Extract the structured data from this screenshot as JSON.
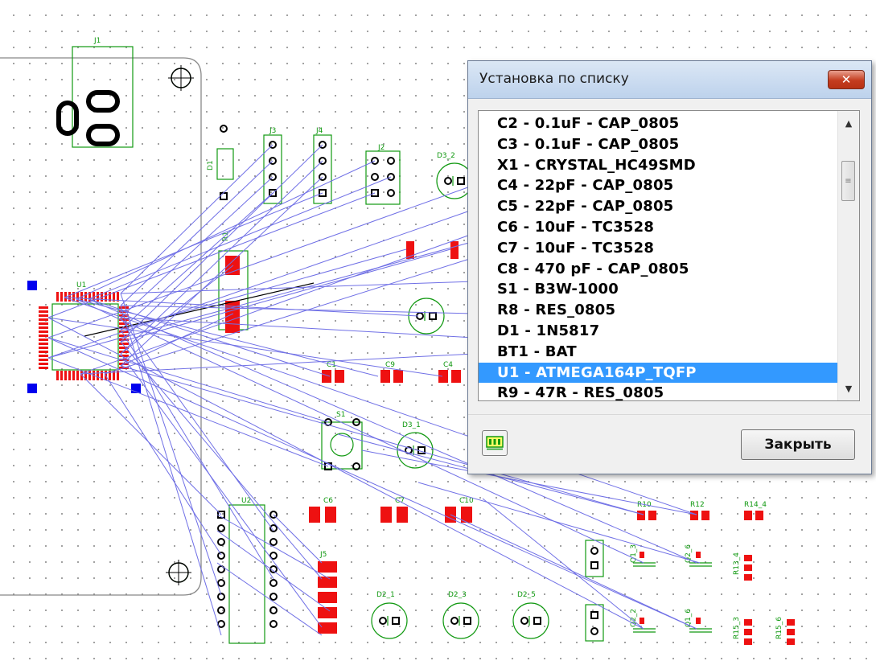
{
  "canvas": {
    "ref_labels": [
      "J1",
      "J3",
      "J4",
      "J2",
      "D1",
      "D3_2",
      "R1",
      "U1",
      "C1",
      "C9",
      "C4",
      "D3_1",
      "S1",
      "U2",
      "C6",
      "C7",
      "C10",
      "R10",
      "R12",
      "R14_4",
      "J5",
      "D2_1",
      "D2_3",
      "D2_5",
      "R13_4",
      "R15_3",
      "R15_6",
      "Q1_3",
      "Q2_6",
      "Q2_2",
      "Q1_6"
    ]
  },
  "dialog": {
    "title": "Установка по списку",
    "close_x": "✕",
    "close_button_label": "Закрыть",
    "items": [
      "C2 - 0.1uF - CAP_0805",
      "C3 - 0.1uF - CAP_0805",
      "X1 - CRYSTAL_HC49SMD",
      "C4 - 22pF - CAP_0805",
      "C5 - 22pF - CAP_0805",
      "C6 - 10uF - TC3528",
      "C7 - 10uF - TC3528",
      "C8 - 470 pF - CAP_0805",
      "S1 - B3W-1000",
      "R8 - RES_0805",
      "D1 - 1N5817",
      "BT1 - BAT",
      "U1 - ATMEGA164P_TQFP",
      "R9 - 47R - RES_0805"
    ],
    "selected_index": 12
  },
  "colors": {
    "ratsnest": "#7070e6",
    "silkscreen": "#119911",
    "pad": "#ee1111",
    "selection": "#3399ff"
  }
}
